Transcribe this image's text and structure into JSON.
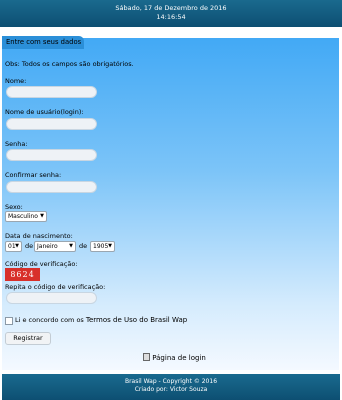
{
  "header": {
    "date": "Sábado, 17 de Dezembro de 2016",
    "time": "14:16:54"
  },
  "form": {
    "title": "Entre com seus dados",
    "note": "Obs: Todos os campos são obrigatórios.",
    "name_label": "Nome:",
    "username_label": "Nome de usuário(login):",
    "password_label": "Senha:",
    "confirm_password_label": "Confirmar senha:",
    "sex_label": "Sexo:",
    "sex_value": "Masculino",
    "birth_label": "Data de nascimento:",
    "birth_day": "01",
    "birth_sep1": "de",
    "birth_month": "Janeiro",
    "birth_sep2": "de",
    "birth_year": "1905",
    "captcha_label": "Código de verificação:",
    "captcha_value": "8624",
    "repeat_captcha_label": "Repita o código de verificação:",
    "terms_prefix": "Li e concordo com os",
    "terms_link": "Termos de Uso do Brasil Wap",
    "submit_label": "Registrar"
  },
  "links": {
    "login": "Página de login",
    "login_icon": "page-icon"
  },
  "footer": {
    "copyright": "Brasil Wap - Copyright © 2016",
    "author": "Criado por: Victor Souza"
  },
  "colors": {
    "header_bg": "#0d4f72",
    "panel_top": "#42a9f5",
    "captcha_bg": "#d8302a"
  }
}
